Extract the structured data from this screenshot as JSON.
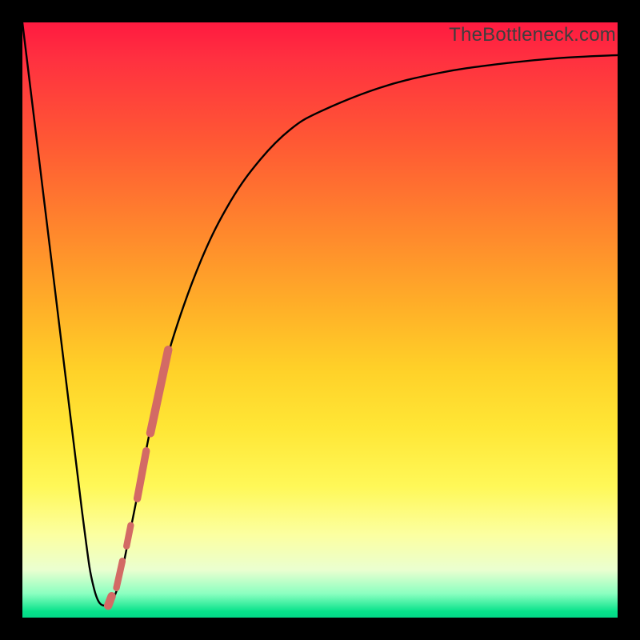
{
  "watermark": "TheBottleneck.com",
  "chart_data": {
    "type": "line",
    "title": "",
    "xlabel": "",
    "ylabel": "",
    "xlim": [
      0,
      100
    ],
    "ylim": [
      0,
      100
    ],
    "grid": false,
    "series": [
      {
        "name": "bottleneck-curve",
        "x": [
          0,
          5,
          10,
          12,
          14,
          16,
          18,
          20,
          22,
          25,
          30,
          35,
          40,
          45,
          50,
          60,
          70,
          80,
          90,
          100
        ],
        "values": [
          100,
          59,
          18,
          5,
          2,
          5,
          14,
          24,
          34,
          46,
          60,
          70,
          77,
          82,
          85,
          89,
          91.5,
          93,
          94,
          94.5
        ]
      }
    ],
    "markers": [
      {
        "name": "marker-segment-a",
        "x0": 21.5,
        "y0": 31,
        "x1": 24.5,
        "y1": 45,
        "w": 10
      },
      {
        "name": "marker-segment-b",
        "x0": 19.3,
        "y0": 20,
        "x1": 20.8,
        "y1": 28,
        "w": 9
      },
      {
        "name": "marker-dot-c",
        "x0": 17.5,
        "y0": 12,
        "x1": 18.2,
        "y1": 15.5,
        "w": 8
      },
      {
        "name": "marker-dot-d",
        "x0": 15.8,
        "y0": 5,
        "x1": 16.8,
        "y1": 9.5,
        "w": 8
      },
      {
        "name": "marker-dot-e",
        "x0": 14.4,
        "y0": 2.0,
        "x1": 15.0,
        "y1": 3.6,
        "w": 10
      }
    ],
    "colors": {
      "curve": "#000000",
      "marker": "#d36a65",
      "gradient_top": "#ff1a40",
      "gradient_bottom": "#04d888"
    }
  }
}
